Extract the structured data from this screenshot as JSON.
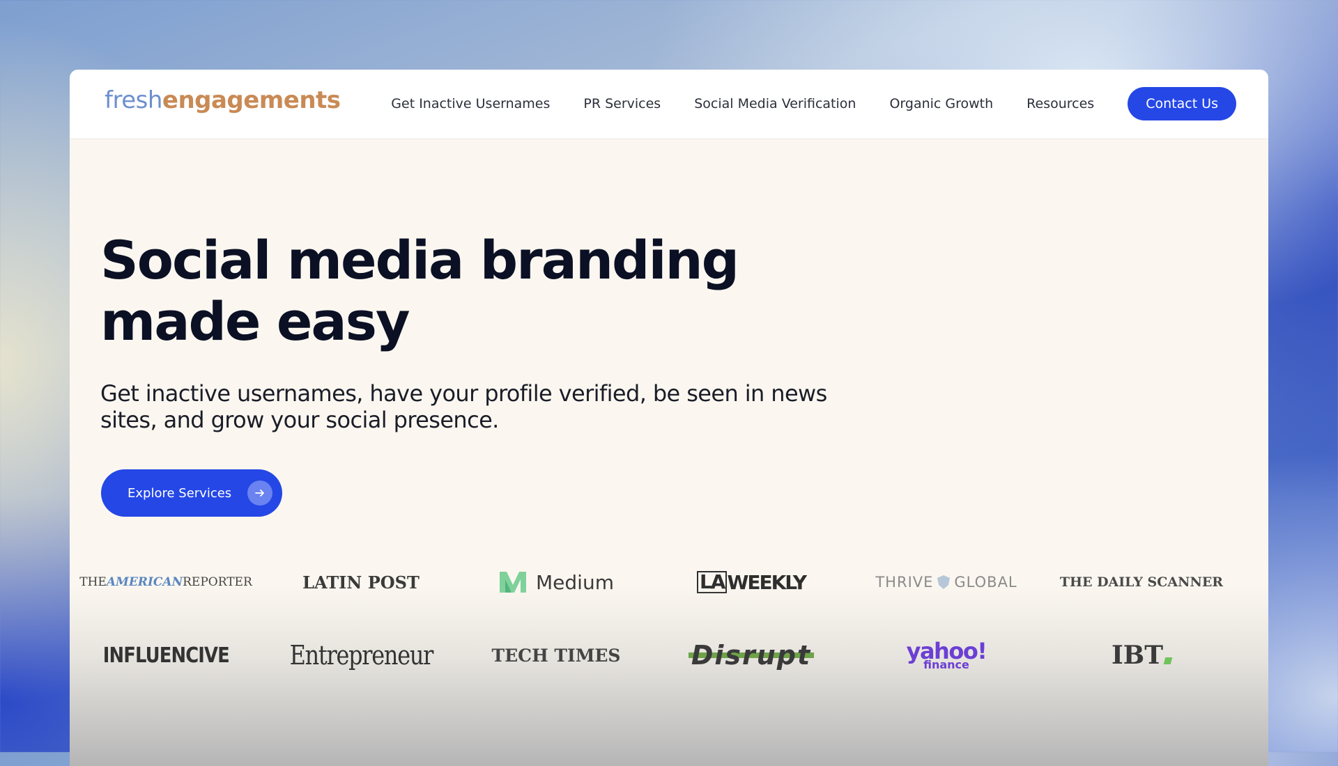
{
  "brand": {
    "part1": "fresh",
    "part2": "engagements",
    "color1": "#6d8fcf",
    "color2": "#c98a55"
  },
  "nav": {
    "links": [
      "Get Inactive Usernames",
      "PR Services",
      "Social Media Verification",
      "Organic Growth",
      "Resources"
    ],
    "cta": "Contact Us"
  },
  "hero": {
    "title_line1": "Social media branding",
    "title_line2": "made easy",
    "subtitle": "Get inactive usernames, have your profile verified, be seen in news sites, and grow your social presence.",
    "button_label": "Explore Services",
    "button_icon": "arrow-right-icon"
  },
  "press_logos": {
    "row1": [
      {
        "parts": [
          "THE",
          "AMERICAN",
          "REPORTER"
        ]
      },
      {
        "text": "LATIN POST"
      },
      {
        "text": "Medium",
        "icon": "medium-logo-icon"
      },
      {
        "parts": [
          "LA",
          "WEEKLY"
        ]
      },
      {
        "parts": [
          "THRIVE",
          "GLOBAL"
        ],
        "icon": "thrive-shield-icon"
      },
      {
        "text": "THE DAILY SCANNER"
      }
    ],
    "row2": [
      {
        "text": "INFLUENCIVE"
      },
      {
        "text": "Entrepreneur"
      },
      {
        "text": "TECH TIMES"
      },
      {
        "text": "Disrupt"
      },
      {
        "parts": [
          "yahoo!",
          "finance"
        ]
      },
      {
        "text": "IBT"
      }
    ]
  },
  "colors": {
    "accent": "#2447e6",
    "page_bg": "#fbf7f0",
    "heading": "#0b1024",
    "yahoo_purple": "#6b3fd4",
    "medium_green": "#7fd19a",
    "disrupt_green": "#6fa34a"
  }
}
